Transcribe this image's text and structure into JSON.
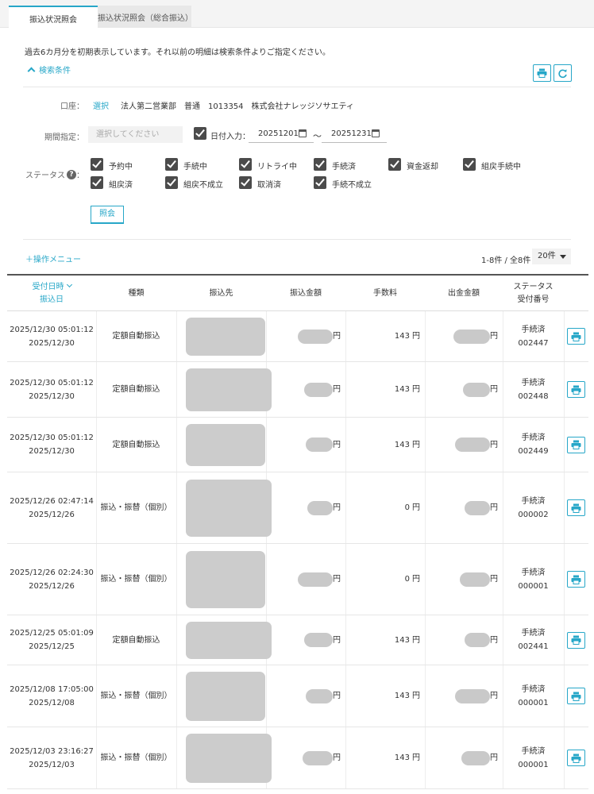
{
  "tabs": [
    {
      "label": "振込状況照会",
      "active": true
    },
    {
      "label": "振込状況照会（総合振込）",
      "active": false
    }
  ],
  "notice": "過去6カ月分を初期表示しています。それ以前の明細は検索条件よりご指定ください。",
  "search_toggle_label": "検索条件",
  "form": {
    "account_label": "口座：",
    "account_select": "選択",
    "account_value": "法人第二営業部　普通　1013354　株式会社ナレッジソサエティ",
    "period_label": "期間指定：",
    "period_placeholder": "選択してください",
    "date_input_label": "日付入力：",
    "date_from": "20251201",
    "date_sep": "〜",
    "date_to": "20251231",
    "status_label": "ステータス",
    "status_help": "?",
    "status_colon": "：",
    "statuses": [
      "予約中",
      "手続中",
      "リトライ中",
      "手続済",
      "資金返却",
      "組戻手続中",
      "組戻済",
      "組戻不成立",
      "取消済",
      "手続不成立"
    ],
    "search_button": "照会"
  },
  "ops_menu": "＋操作メニュー",
  "count_text": "1-8件 / 全8件",
  "per_page": "20件",
  "table": {
    "headers": {
      "date1": "受付日時",
      "date2": "振込日",
      "type": "種類",
      "dest": "振込先",
      "amount": "振込金額",
      "fee": "手数料",
      "out_amount": "出金金額",
      "status1": "ステータス",
      "status2": "受付番号"
    },
    "currency": "円",
    "rows": [
      {
        "accepted": "2025/12/30 05:01:12",
        "date": "2025/12/30",
        "type": "定額自動振込",
        "fee": "143",
        "status": "手続済",
        "number": "002447"
      },
      {
        "accepted": "2025/12/30 05:01:12",
        "date": "2025/12/30",
        "type": "定額自動振込",
        "fee": "143",
        "status": "手続済",
        "number": "002448"
      },
      {
        "accepted": "2025/12/30 05:01:12",
        "date": "2025/12/30",
        "type": "定額自動振込",
        "fee": "143",
        "status": "手続済",
        "number": "002449"
      },
      {
        "accepted": "2025/12/26 02:47:14",
        "date": "2025/12/26",
        "type": "振込・振替（個別）",
        "fee": "0",
        "status": "手続済",
        "number": "000002"
      },
      {
        "accepted": "2025/12/26 02:24:30",
        "date": "2025/12/26",
        "type": "振込・振替（個別）",
        "fee": "0",
        "status": "手続済",
        "number": "000001"
      },
      {
        "accepted": "2025/12/25 05:01:09",
        "date": "2025/12/25",
        "type": "定額自動振込",
        "fee": "143",
        "status": "手続済",
        "number": "002441"
      },
      {
        "accepted": "2025/12/08 17:05:00",
        "date": "2025/12/08",
        "type": "振込・振替（個別）",
        "fee": "143",
        "status": "手続済",
        "number": "000001"
      },
      {
        "accepted": "2025/12/03 23:16:27",
        "date": "2025/12/03",
        "type": "振込・振替（個別）",
        "fee": "143",
        "status": "手続済",
        "number": "000001"
      }
    ]
  },
  "colors": {
    "accent": "#27a7c8",
    "checkbox": "#4b4b4b"
  }
}
